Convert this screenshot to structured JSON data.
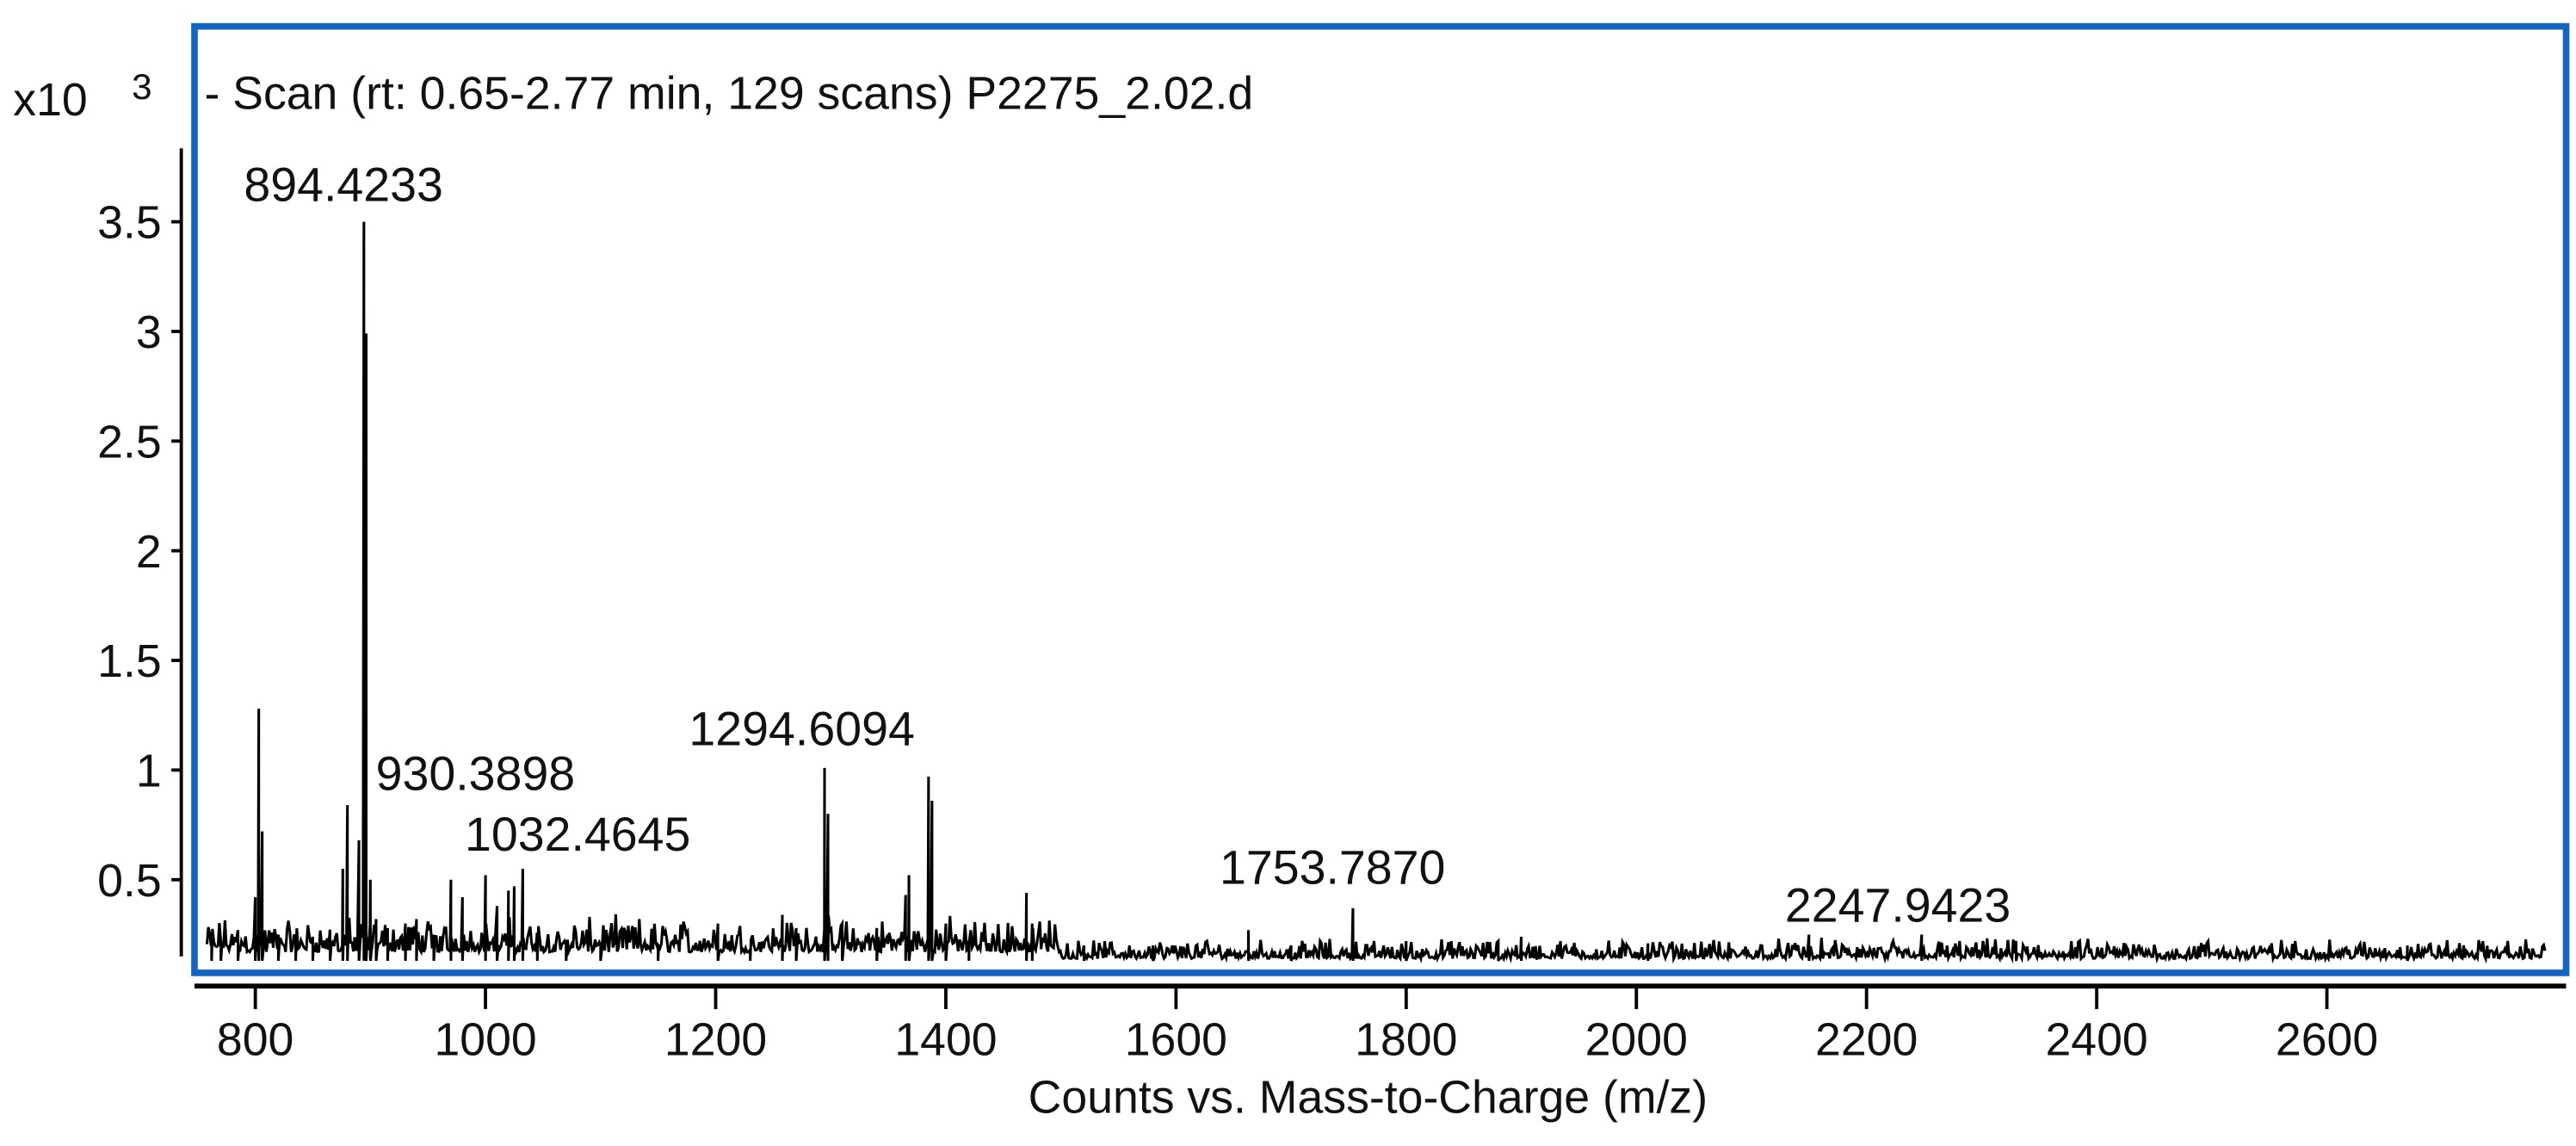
{
  "chart_data": {
    "type": "line",
    "title": "- Scan (rt: 0.65-2.77 min, 129 scans) P2275_2.02.d",
    "xlabel": "Counts vs. Mass-to-Charge (m/z)",
    "ylabel": "",
    "y_multiplier": "x10",
    "y_multiplier_exp": "3",
    "xlim": [
      750,
      2805
    ],
    "ylim": [
      0,
      3.85
    ],
    "xticks": [
      "800",
      "1000",
      "1200",
      "1400",
      "1600",
      "1800",
      "2000",
      "2200",
      "2400",
      "2600"
    ],
    "xtick_values": [
      800,
      1000,
      1200,
      1400,
      1600,
      1800,
      2000,
      2200,
      2400,
      2600
    ],
    "yticks": [
      "0.5",
      "1",
      "1.5",
      "2",
      "2.5",
      "3",
      "3.5"
    ],
    "ytick_values": [
      0.5,
      1,
      1.5,
      2,
      2.5,
      3,
      3.5
    ],
    "grid": false,
    "noise_floor": 0.12,
    "peaks": [
      [
        762,
        0.25
      ],
      [
        770,
        0.22
      ],
      [
        785,
        0.27
      ],
      [
        800,
        0.42
      ],
      [
        803,
        1.28
      ],
      [
        806,
        0.72
      ],
      [
        820,
        0.25
      ],
      [
        835,
        0.22
      ],
      [
        850,
        0.24
      ],
      [
        865,
        0.2
      ],
      [
        876,
        0.55
      ],
      [
        880,
        0.84
      ],
      [
        890,
        0.68
      ],
      [
        894.42,
        3.5
      ],
      [
        896.4,
        2.99
      ],
      [
        900,
        0.5
      ],
      [
        905,
        0.32
      ],
      [
        915,
        0.28
      ],
      [
        930.39,
        0.3
      ],
      [
        940,
        0.32
      ],
      [
        955,
        0.25
      ],
      [
        970,
        0.5
      ],
      [
        980,
        0.42
      ],
      [
        1000,
        0.52
      ],
      [
        1010,
        0.38
      ],
      [
        1020,
        0.45
      ],
      [
        1025,
        0.47
      ],
      [
        1032.46,
        0.55
      ],
      [
        1045,
        0.22
      ],
      [
        1070,
        0.2
      ],
      [
        1100,
        0.2
      ],
      [
        1150,
        0.18
      ],
      [
        1202,
        0.3
      ],
      [
        1230,
        0.18
      ],
      [
        1258,
        0.34
      ],
      [
        1270,
        0.28
      ],
      [
        1294.61,
        1.01
      ],
      [
        1297.6,
        0.8
      ],
      [
        1310,
        0.3
      ],
      [
        1340,
        0.28
      ],
      [
        1365,
        0.43
      ],
      [
        1368,
        0.52
      ],
      [
        1385,
        0.97
      ],
      [
        1388,
        0.86
      ],
      [
        1400,
        0.3
      ],
      [
        1420,
        0.22
      ],
      [
        1470,
        0.44
      ],
      [
        1475,
        0.3
      ],
      [
        1520,
        0.2
      ],
      [
        1580,
        0.2
      ],
      [
        1663,
        0.27
      ],
      [
        1700,
        0.2
      ],
      [
        1753.79,
        0.37
      ],
      [
        1800,
        0.22
      ],
      [
        1880,
        0.22
      ],
      [
        1900,
        0.24
      ],
      [
        2010,
        0.21
      ],
      [
        2150,
        0.25
      ],
      [
        2247.94,
        0.25
      ],
      [
        2330,
        0.22
      ],
      [
        2670,
        0.2
      ]
    ],
    "annotations": [
      {
        "label": "894.4233",
        "mz": 894.4233
      },
      {
        "label": "930.3898",
        "mz": 930.3898
      },
      {
        "label": "1032.4645",
        "mz": 1032.4645
      },
      {
        "label": "1294.6094",
        "mz": 1294.6094
      },
      {
        "label": "1753.7870",
        "mz": 1753.787
      },
      {
        "label": "2247.9423",
        "mz": 2247.9423
      }
    ],
    "colors": {
      "frame": "#1565c0",
      "trace": "#000000"
    }
  }
}
